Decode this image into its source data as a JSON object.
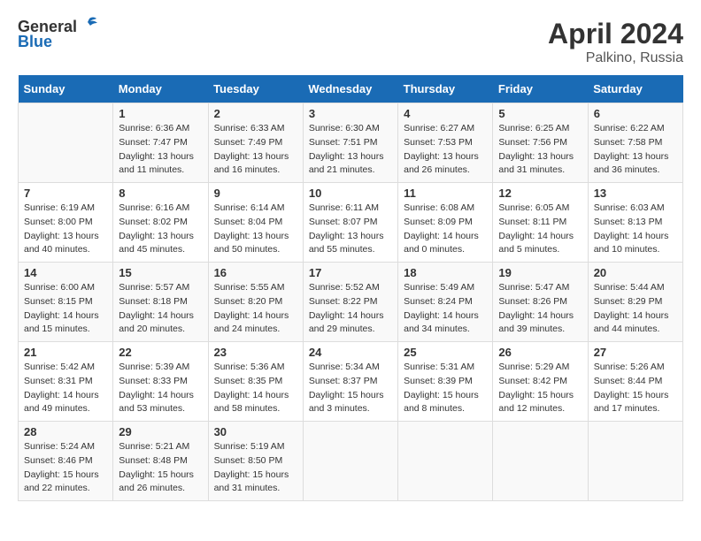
{
  "header": {
    "logo_general": "General",
    "logo_blue": "Blue",
    "month_year": "April 2024",
    "location": "Palkino, Russia"
  },
  "days_of_week": [
    "Sunday",
    "Monday",
    "Tuesday",
    "Wednesday",
    "Thursday",
    "Friday",
    "Saturday"
  ],
  "weeks": [
    [
      {
        "day": "",
        "info": ""
      },
      {
        "day": "1",
        "info": "Sunrise: 6:36 AM\nSunset: 7:47 PM\nDaylight: 13 hours\nand 11 minutes."
      },
      {
        "day": "2",
        "info": "Sunrise: 6:33 AM\nSunset: 7:49 PM\nDaylight: 13 hours\nand 16 minutes."
      },
      {
        "day": "3",
        "info": "Sunrise: 6:30 AM\nSunset: 7:51 PM\nDaylight: 13 hours\nand 21 minutes."
      },
      {
        "day": "4",
        "info": "Sunrise: 6:27 AM\nSunset: 7:53 PM\nDaylight: 13 hours\nand 26 minutes."
      },
      {
        "day": "5",
        "info": "Sunrise: 6:25 AM\nSunset: 7:56 PM\nDaylight: 13 hours\nand 31 minutes."
      },
      {
        "day": "6",
        "info": "Sunrise: 6:22 AM\nSunset: 7:58 PM\nDaylight: 13 hours\nand 36 minutes."
      }
    ],
    [
      {
        "day": "7",
        "info": "Sunrise: 6:19 AM\nSunset: 8:00 PM\nDaylight: 13 hours\nand 40 minutes."
      },
      {
        "day": "8",
        "info": "Sunrise: 6:16 AM\nSunset: 8:02 PM\nDaylight: 13 hours\nand 45 minutes."
      },
      {
        "day": "9",
        "info": "Sunrise: 6:14 AM\nSunset: 8:04 PM\nDaylight: 13 hours\nand 50 minutes."
      },
      {
        "day": "10",
        "info": "Sunrise: 6:11 AM\nSunset: 8:07 PM\nDaylight: 13 hours\nand 55 minutes."
      },
      {
        "day": "11",
        "info": "Sunrise: 6:08 AM\nSunset: 8:09 PM\nDaylight: 14 hours\nand 0 minutes."
      },
      {
        "day": "12",
        "info": "Sunrise: 6:05 AM\nSunset: 8:11 PM\nDaylight: 14 hours\nand 5 minutes."
      },
      {
        "day": "13",
        "info": "Sunrise: 6:03 AM\nSunset: 8:13 PM\nDaylight: 14 hours\nand 10 minutes."
      }
    ],
    [
      {
        "day": "14",
        "info": "Sunrise: 6:00 AM\nSunset: 8:15 PM\nDaylight: 14 hours\nand 15 minutes."
      },
      {
        "day": "15",
        "info": "Sunrise: 5:57 AM\nSunset: 8:18 PM\nDaylight: 14 hours\nand 20 minutes."
      },
      {
        "day": "16",
        "info": "Sunrise: 5:55 AM\nSunset: 8:20 PM\nDaylight: 14 hours\nand 24 minutes."
      },
      {
        "day": "17",
        "info": "Sunrise: 5:52 AM\nSunset: 8:22 PM\nDaylight: 14 hours\nand 29 minutes."
      },
      {
        "day": "18",
        "info": "Sunrise: 5:49 AM\nSunset: 8:24 PM\nDaylight: 14 hours\nand 34 minutes."
      },
      {
        "day": "19",
        "info": "Sunrise: 5:47 AM\nSunset: 8:26 PM\nDaylight: 14 hours\nand 39 minutes."
      },
      {
        "day": "20",
        "info": "Sunrise: 5:44 AM\nSunset: 8:29 PM\nDaylight: 14 hours\nand 44 minutes."
      }
    ],
    [
      {
        "day": "21",
        "info": "Sunrise: 5:42 AM\nSunset: 8:31 PM\nDaylight: 14 hours\nand 49 minutes."
      },
      {
        "day": "22",
        "info": "Sunrise: 5:39 AM\nSunset: 8:33 PM\nDaylight: 14 hours\nand 53 minutes."
      },
      {
        "day": "23",
        "info": "Sunrise: 5:36 AM\nSunset: 8:35 PM\nDaylight: 14 hours\nand 58 minutes."
      },
      {
        "day": "24",
        "info": "Sunrise: 5:34 AM\nSunset: 8:37 PM\nDaylight: 15 hours\nand 3 minutes."
      },
      {
        "day": "25",
        "info": "Sunrise: 5:31 AM\nSunset: 8:39 PM\nDaylight: 15 hours\nand 8 minutes."
      },
      {
        "day": "26",
        "info": "Sunrise: 5:29 AM\nSunset: 8:42 PM\nDaylight: 15 hours\nand 12 minutes."
      },
      {
        "day": "27",
        "info": "Sunrise: 5:26 AM\nSunset: 8:44 PM\nDaylight: 15 hours\nand 17 minutes."
      }
    ],
    [
      {
        "day": "28",
        "info": "Sunrise: 5:24 AM\nSunset: 8:46 PM\nDaylight: 15 hours\nand 22 minutes."
      },
      {
        "day": "29",
        "info": "Sunrise: 5:21 AM\nSunset: 8:48 PM\nDaylight: 15 hours\nand 26 minutes."
      },
      {
        "day": "30",
        "info": "Sunrise: 5:19 AM\nSunset: 8:50 PM\nDaylight: 15 hours\nand 31 minutes."
      },
      {
        "day": "",
        "info": ""
      },
      {
        "day": "",
        "info": ""
      },
      {
        "day": "",
        "info": ""
      },
      {
        "day": "",
        "info": ""
      }
    ]
  ]
}
